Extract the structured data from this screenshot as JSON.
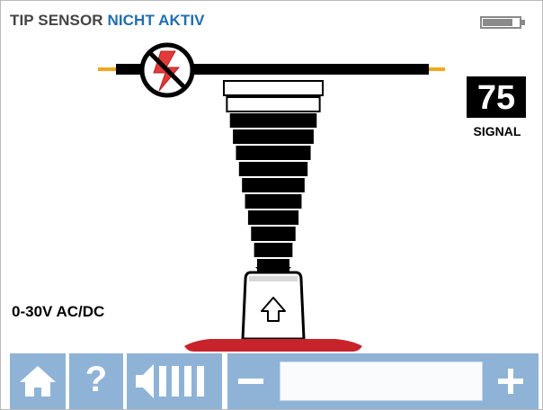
{
  "header": {
    "title_prefix": "TIP SENSOR",
    "title_status": "NICHT AKTIV",
    "status_color": "#1f6fb0",
    "battery_icon": "battery-low-icon"
  },
  "signal": {
    "value": "75",
    "label": "SIGNAL"
  },
  "voltage_range": "0-30V AC/DC",
  "toolbar": {
    "home_icon": "home-icon",
    "help_label": "?",
    "volume_icon": "speaker-volume-icon",
    "decrease_icon": "minus-icon",
    "increase_icon": "plus-icon",
    "button_color": "#8fb3d6"
  },
  "signal_bars": {
    "total": 12,
    "active": 10
  }
}
